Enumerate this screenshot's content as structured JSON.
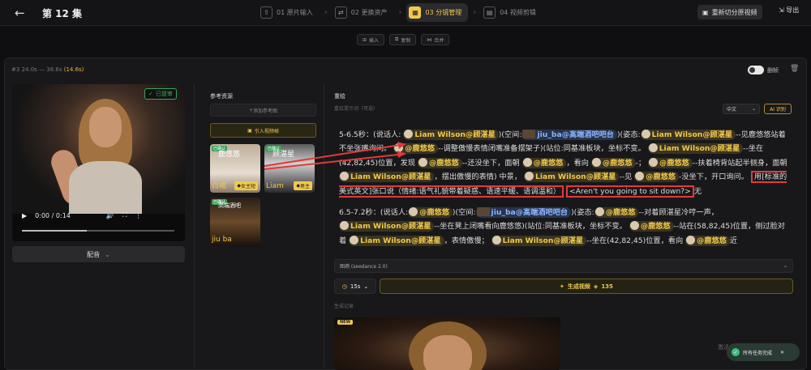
{
  "header": {
    "title": "第 12 集",
    "regenerate": "重新切分原视频",
    "export": "导出"
  },
  "steps": [
    {
      "label": "01 原片输入",
      "icon": "upload-icon"
    },
    {
      "label": "02 更换资产",
      "icon": "swap-icon"
    },
    {
      "label": "03 分镜管理",
      "icon": "storyboard-icon"
    },
    {
      "label": "04 视频剪辑",
      "icon": "film-icon"
    }
  ],
  "tools": {
    "insert": "插入",
    "copy": "复制",
    "merge": "合并"
  },
  "shot": {
    "index": "#3",
    "range": "24.0s — 38.6s",
    "duration": "(14.6s)",
    "toggle_label": "删帧"
  },
  "video": {
    "confirmed": "已提审",
    "time": "0:00 / 0:14",
    "dub": "配音"
  },
  "refs": {
    "title": "参考资源",
    "add": "添加参考图",
    "import": "引入视频帧",
    "items": [
      {
        "badge": "已确认",
        "name": "鹿悠悠",
        "sub": "白裙",
        "role": "女主短"
      },
      {
        "badge": "已确认",
        "name": "顾湛星",
        "sub": "Liam",
        "role": "男主"
      },
      {
        "badge": "已确认",
        "name": "高端酒吧",
        "sub": "jiu ba"
      }
    ]
  },
  "draw": {
    "title": "重绘",
    "subtitle": "重绘提示词（可选）",
    "lang": "中文",
    "ai": "AI 识别"
  },
  "script": {
    "s1_time": "5-6.5秒：(说话人:",
    "s1_space": ")(空间:",
    "s1_pose": ")(姿态:",
    "s1_t1": "--见鹿悠悠站着不坐张嘴询问。",
    "s1_t2": "--调整傲慢表情闭嘴准备摆架子)(站位:同基准板块，坐标不变。",
    "s1_t3": "--坐在(42,82,45)位置，发现",
    "s1_t4": "--还没坐下，面朝",
    "s1_t5": "，看向",
    "s1_t6": "-；",
    "s1_t7": "--扶着椅背站起半侧身，面朝",
    "s1_t8": "，摆出傲慢的表情) 中景，",
    "s1_t9": "--见",
    "s1_t10": "-没坐下，开口询问。",
    "s1_say": "用[标准的美式英文]张口说（情绪:语气礼貌带着疑惑、语速平缓、语调温和）",
    "s1_quote": "<Aren't you going to sit down?>",
    "s1_end": "无",
    "s2_time": "6.5-7.2秒：(说话人:",
    "s2_t1": "--对着顾湛星冷哼一声，",
    "s2_t2": "--坐在凳上闭嘴看向鹿悠悠)(站位:同基准板块，坐标不变。",
    "s2_t3": "--站在(58,82,45)位置，侧过脸对着",
    "s2_t4": "，表情傲慢；",
    "s2_t5": "--坐在(42,82,45)位置，看向",
    "s2_t6": "近",
    "liam": "Liam Wilson@顾湛星",
    "lu": "@鹿悠悠",
    "bar": "jiu_ba@高端酒吧吧台"
  },
  "model": "图鹉 (seedance 2.0)",
  "gen": {
    "duration": "15s",
    "label": "生成视频",
    "cost": "135"
  },
  "records": {
    "title": "生成记录",
    "new": "NEW"
  },
  "toast": {
    "watermark": "激活 Windows",
    "text": "所有任务完成"
  }
}
